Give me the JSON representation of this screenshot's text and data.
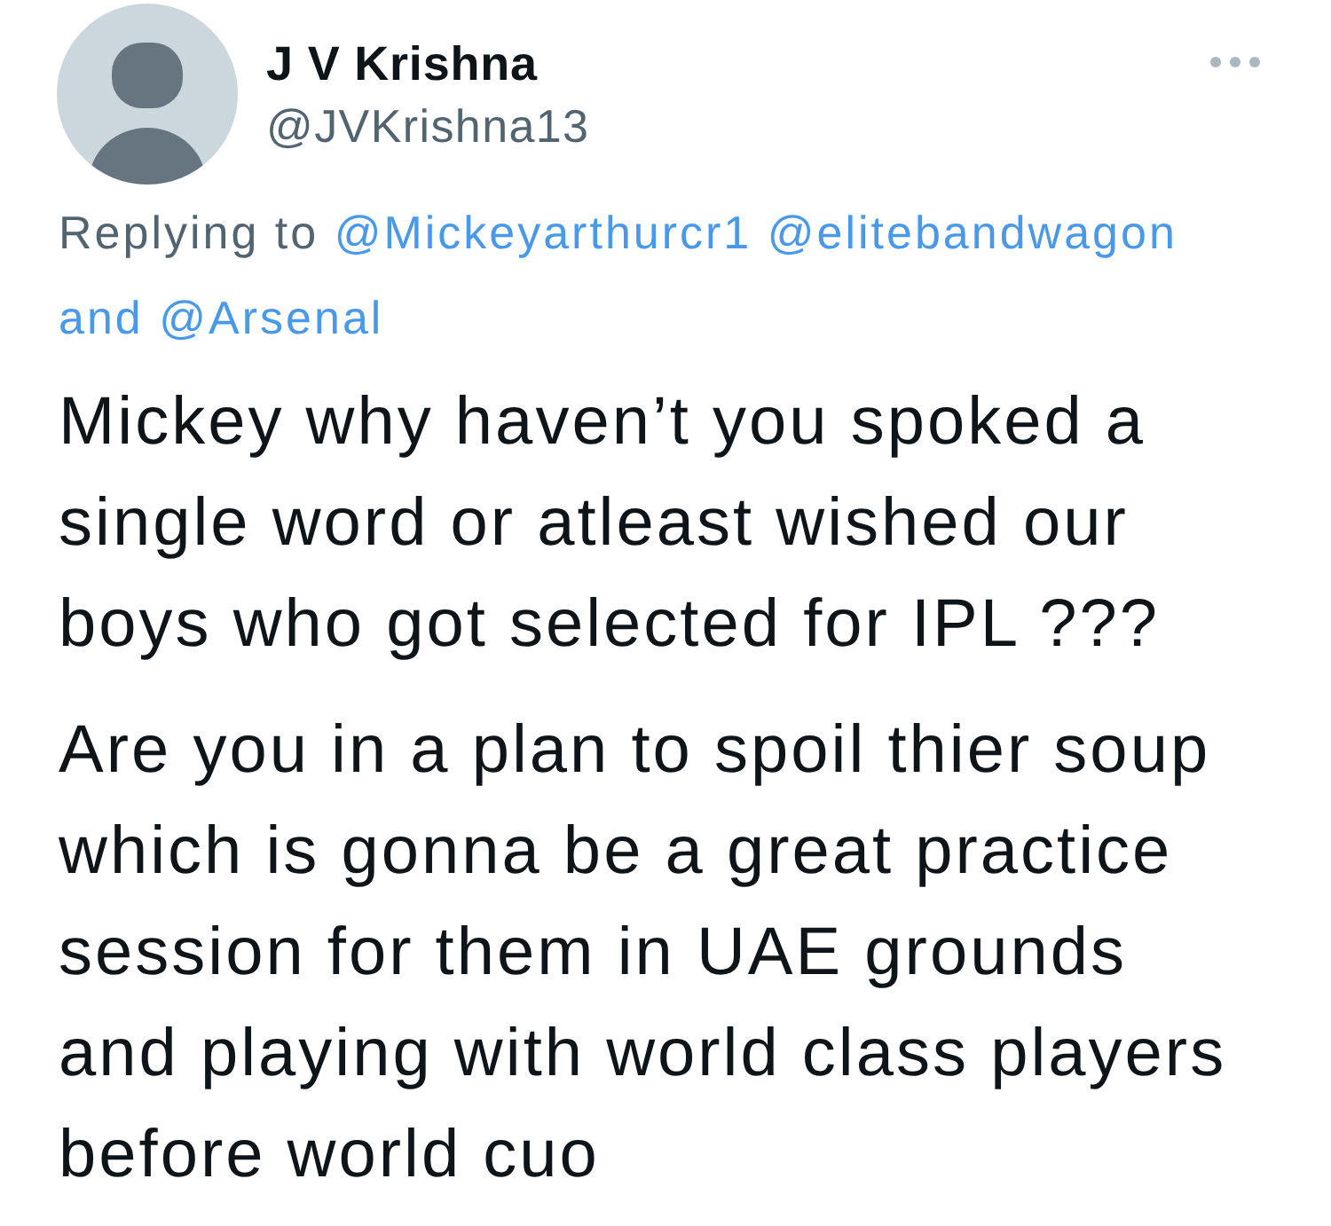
{
  "author": {
    "name": "J V Krishna",
    "handle": "@JVKrishna13"
  },
  "reply_context": {
    "prefix": "Replying to",
    "mentions": [
      "@Mickeyarthurcr1",
      "@elitebandwagon"
    ],
    "conjunction": "and",
    "last_mention": "@Arsenal"
  },
  "paragraphs": [
    "Mickey why haven’t you spoked a single word or atleast wished our boys who got selected for IPL ???",
    "Are you in a plan to spoil thier soup which is gonna be a great practice session for them in UAE grounds and playing with world class players before world cuo"
  ]
}
